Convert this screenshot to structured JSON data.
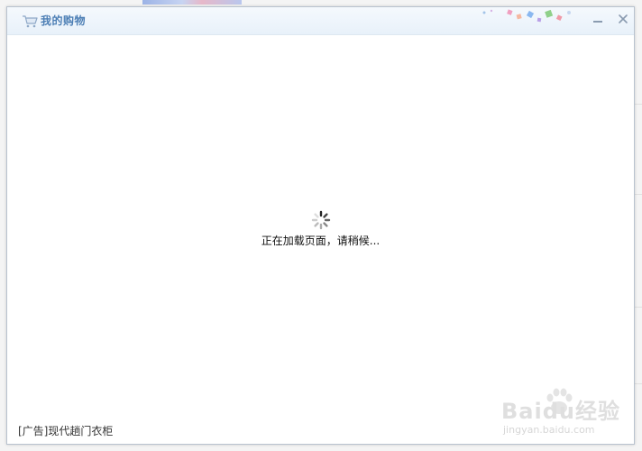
{
  "window": {
    "title": "我的购物",
    "icons": {
      "title": "shopping-cart-icon",
      "minimize": "minimize-icon",
      "close": "close-icon",
      "loading": "loading-spinner-icon"
    }
  },
  "main": {
    "loading_text": "正在加载页面，请稍候..."
  },
  "footer": {
    "ad_text": "[广告]现代趟门衣柜"
  },
  "watermark": {
    "brand": "Baidu经验",
    "url": "jingyan.baidu.com"
  },
  "colors": {
    "title": "#4d7fb5",
    "titlebar_top": "#f5f9fd",
    "titlebar_bottom": "#e8f1fa",
    "border": "#b9c3cf"
  }
}
